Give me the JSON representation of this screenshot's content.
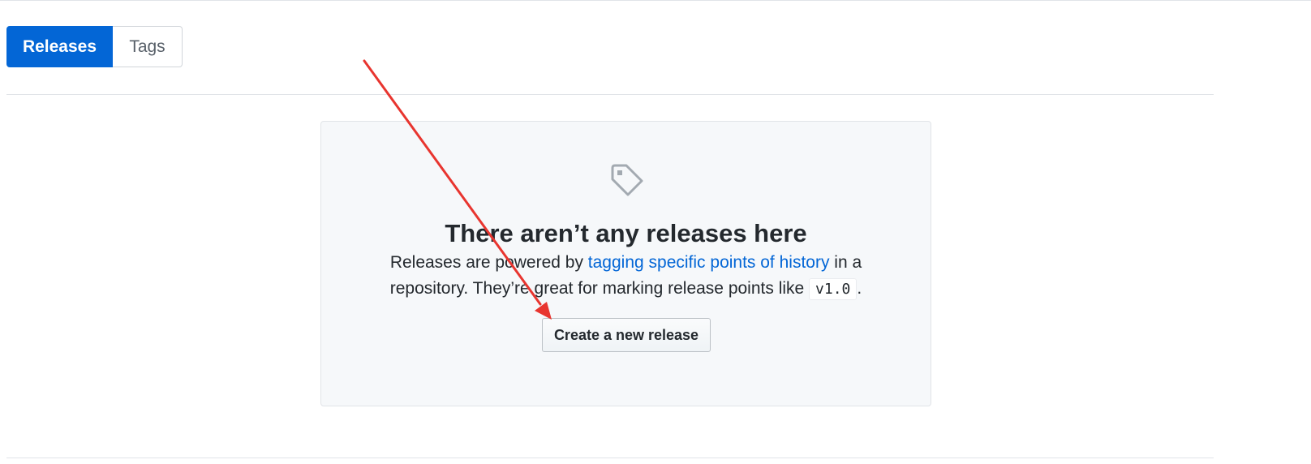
{
  "subnav": {
    "tabs": [
      {
        "label": "Releases",
        "selected": true
      },
      {
        "label": "Tags",
        "selected": false
      }
    ]
  },
  "blankslate": {
    "icon": "tag-icon",
    "title": "There aren’t any releases here",
    "description": {
      "before_link": "Releases are powered by ",
      "link_text": "tagging specific points of history",
      "after_link": " in a repository. They’re great for marking release points like ",
      "code": "v1.0",
      "end": "."
    },
    "button_label": "Create a new release"
  },
  "colors": {
    "accent": "#0366d6",
    "annotation": "#e8352f"
  }
}
